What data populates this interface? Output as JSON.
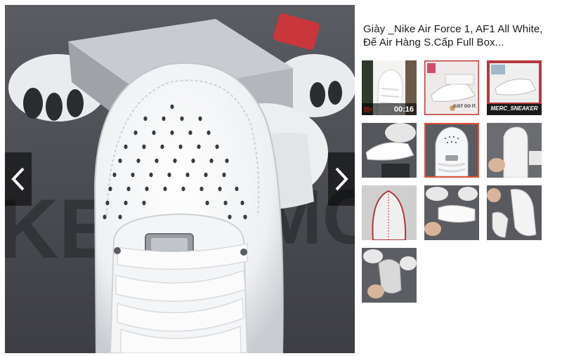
{
  "product": {
    "title": "Giày _Nike Air Force 1, AF1 All White, Đế Air Hàng S.Cấp Full Box..."
  },
  "viewer": {
    "prev_icon": "chevron-left-icon",
    "next_icon": "chevron-right-icon"
  },
  "thumbnails": [
    {
      "kind": "video",
      "duration": "00:16",
      "selected": false
    },
    {
      "kind": "image",
      "selected": false,
      "caption": "JUST DO IT."
    },
    {
      "kind": "image",
      "selected": false,
      "caption": "MERC_SNEAKER"
    },
    {
      "kind": "image",
      "selected": false
    },
    {
      "kind": "image",
      "selected": true
    },
    {
      "kind": "image",
      "selected": false
    },
    {
      "kind": "image",
      "selected": false
    },
    {
      "kind": "image",
      "selected": false
    },
    {
      "kind": "image",
      "selected": false
    },
    {
      "kind": "image",
      "selected": false
    }
  ],
  "colors": {
    "selected_border": "#e0533a",
    "nav_overlay": "rgba(0,0,0,0.55)"
  }
}
